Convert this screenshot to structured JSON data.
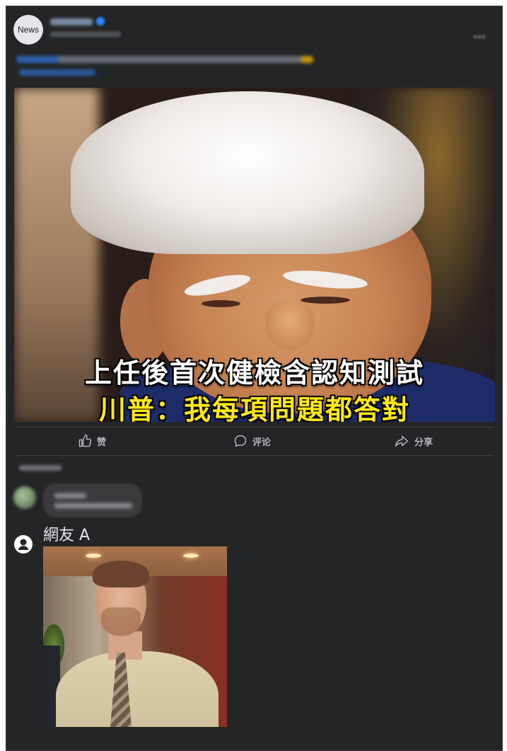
{
  "post": {
    "author_avatar_text": "News"
  },
  "media": {
    "subtitle_line1": "上任後首次健檢含認知測試",
    "subtitle_line2": "川普：我每項問題都答對"
  },
  "actions": {
    "like_label": "赞",
    "comment_label": "评论",
    "share_label": "分享"
  },
  "comment": {
    "author": "網友 A",
    "avatar_icon": "user-icon",
    "attachment": "meme-image"
  },
  "colors": {
    "background": "#242526",
    "text_primary": "#e4e6eb",
    "text_secondary": "#b0b3b8",
    "subtitle_white": "#ffffff",
    "subtitle_yellow": "#ffe81a"
  }
}
